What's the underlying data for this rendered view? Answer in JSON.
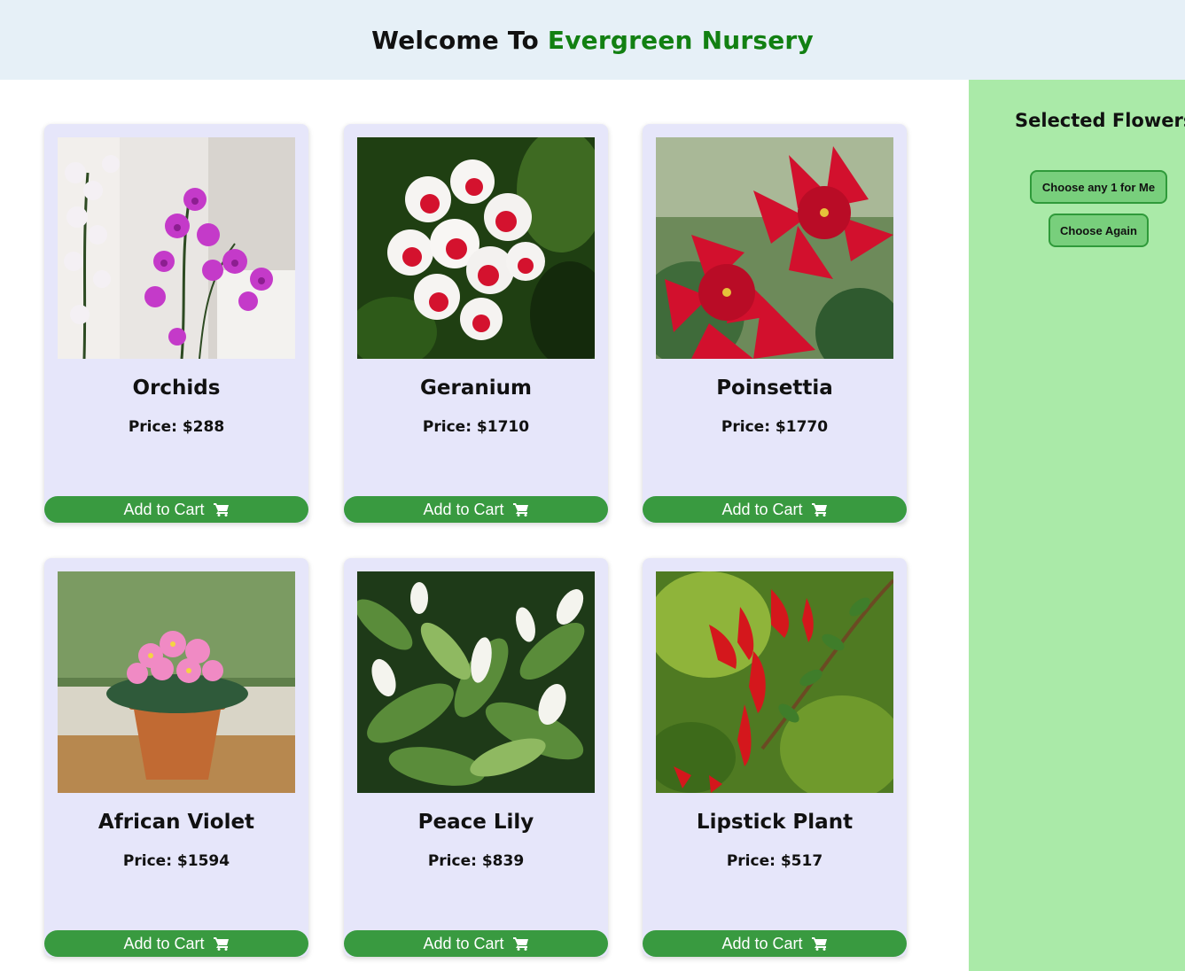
{
  "header": {
    "title_prefix": "Welcome To ",
    "title_brand": "Evergreen Nursery"
  },
  "products": [
    {
      "name": "Orchids",
      "price": "Price: $288",
      "button_label": "Add to Cart"
    },
    {
      "name": "Geranium",
      "price": "Price: $1710",
      "button_label": "Add to Cart"
    },
    {
      "name": "Poinsettia",
      "price": "Price: $1770",
      "button_label": "Add to Cart"
    },
    {
      "name": "African Violet",
      "price": "Price: $1594",
      "button_label": "Add to Cart"
    },
    {
      "name": "Peace Lily",
      "price": "Price: $839",
      "button_label": "Add to Cart"
    },
    {
      "name": "Lipstick Plant",
      "price": "Price: $517",
      "button_label": "Add to Cart"
    }
  ],
  "sidebar": {
    "title": "Selected Flowers",
    "choose_button": "Choose any 1 for Me",
    "again_button": "Choose Again"
  },
  "colors": {
    "header_bg": "#e6f0f7",
    "brand_green": "#128012",
    "card_bg": "#e6e6fa",
    "button_green": "#399a40",
    "sidebar_bg": "#aaeaa8"
  },
  "icons": {
    "cart": "shopping-cart-icon"
  }
}
